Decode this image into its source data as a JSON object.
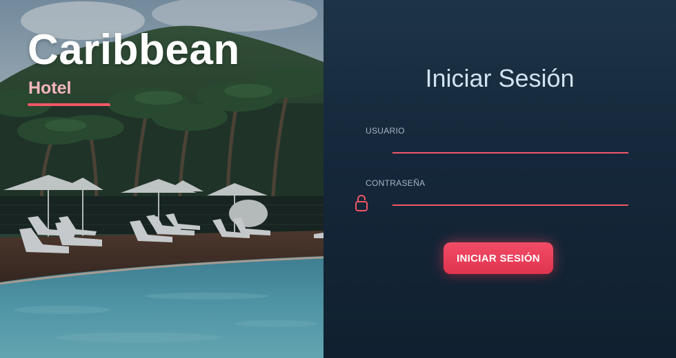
{
  "brand": {
    "title": "Caribbean",
    "subtitle": "Hotel"
  },
  "login": {
    "heading": "Iniciar Sesión",
    "username_label": "USUARIO",
    "username_value": "",
    "password_label": "CONTRASEÑA",
    "password_value": "",
    "submit_label": "INICIAR SESIÓN"
  },
  "icons": {
    "password": "lock-icon"
  },
  "colors": {
    "accent": "#f25767",
    "button": "#ea3e5a",
    "panel_background": "#15273a",
    "heading_text": "#cfe3f4",
    "subtitle_text": "#f4b7bd"
  }
}
